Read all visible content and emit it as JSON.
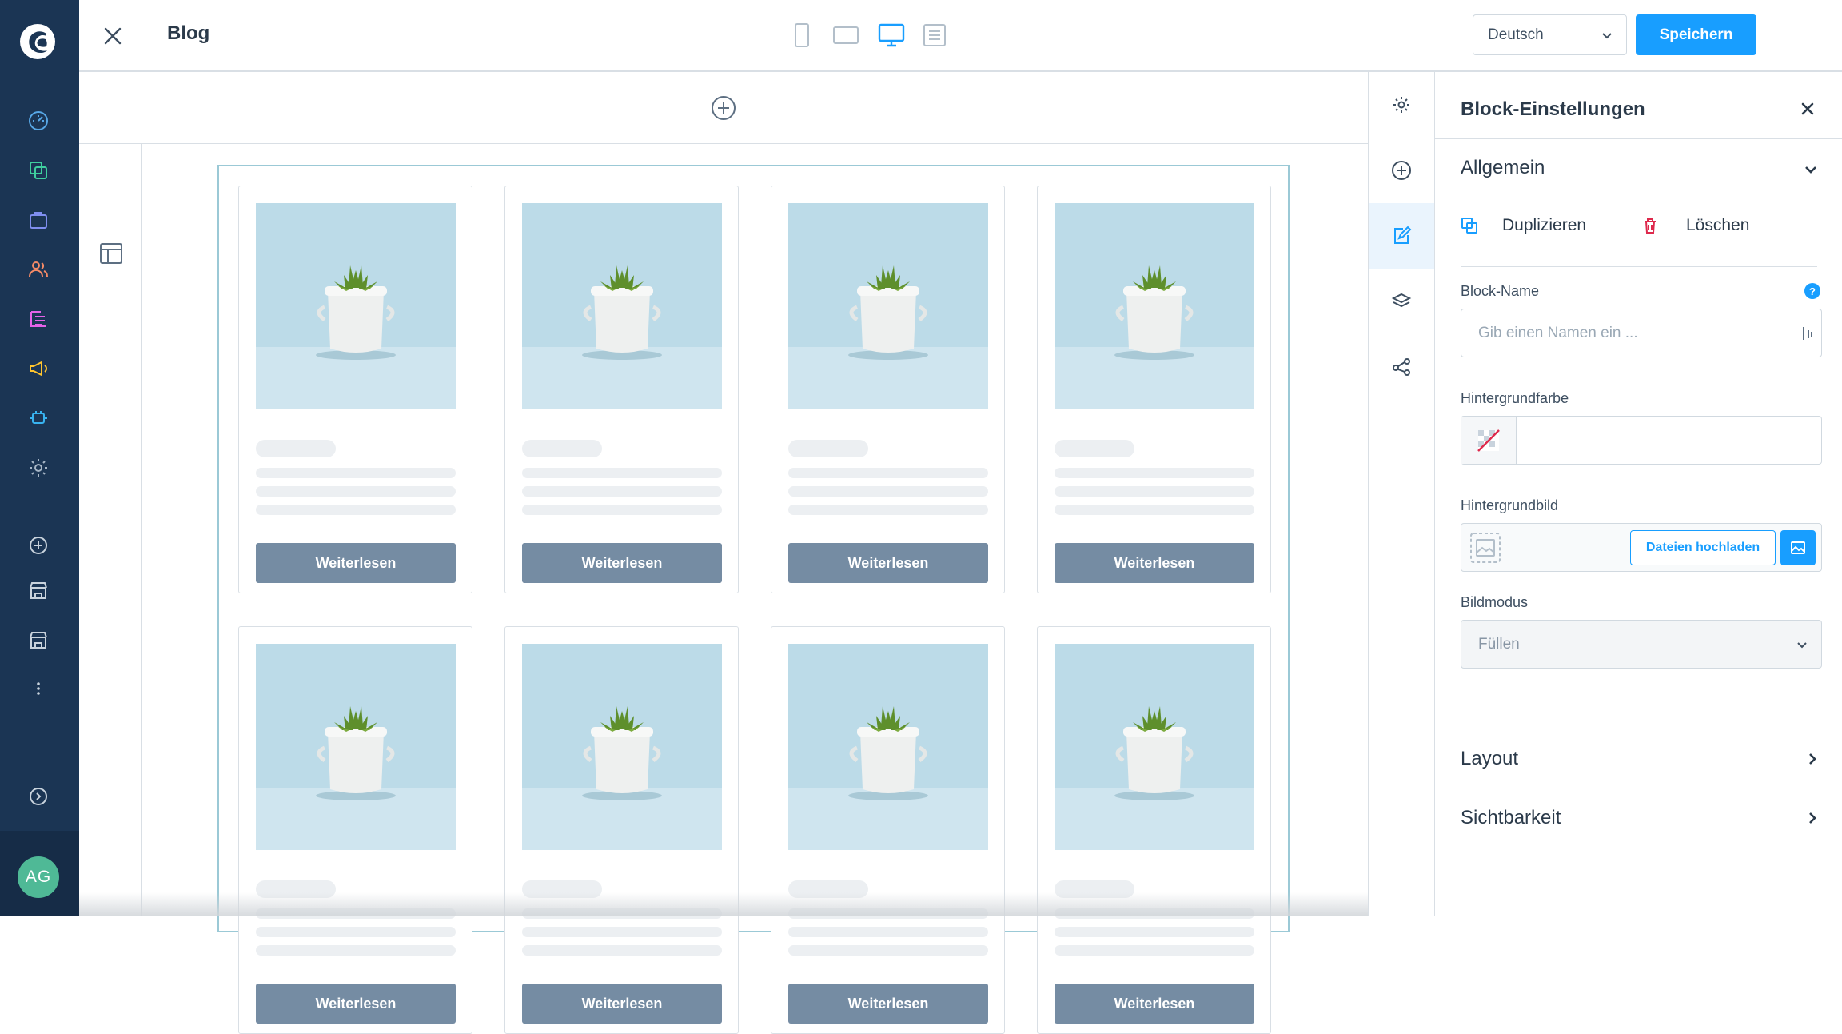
{
  "nav": {
    "avatar_initials": "AG",
    "items": [
      "dashboard-icon",
      "catalogues-icon",
      "orders-icon",
      "customers-icon",
      "content-icon",
      "marketing-icon",
      "extensions-icon",
      "settings-icon",
      "add-sales-channel-icon",
      "storefront-icon",
      "storefront-icon",
      "more-icon",
      "help-icon"
    ]
  },
  "topbar": {
    "title": "Blog",
    "language": "Deutsch",
    "save_label": "Speichern",
    "active_device": "desktop"
  },
  "canvas": {
    "cards": [
      {
        "button_label": "Weiterlesen"
      },
      {
        "button_label": "Weiterlesen"
      },
      {
        "button_label": "Weiterlesen"
      },
      {
        "button_label": "Weiterlesen"
      },
      {
        "button_label": "Weiterlesen"
      },
      {
        "button_label": "Weiterlesen"
      },
      {
        "button_label": "Weiterlesen"
      },
      {
        "button_label": "Weiterlesen"
      }
    ]
  },
  "panel": {
    "title": "Block-Einstellungen",
    "section_general": "Allgemein",
    "duplicate_label": "Duplizieren",
    "delete_label": "Löschen",
    "block_name_label": "Block-Name",
    "block_name_placeholder": "Gib einen Namen ein ...",
    "help_glyph": "?",
    "background_color_label": "Hintergrundfarbe",
    "background_image_label": "Hintergrundbild",
    "upload_label": "Dateien hochladen",
    "image_mode_label": "Bildmodus",
    "image_mode_value": "Füllen",
    "section_layout": "Layout",
    "section_visibility": "Sichtbarkeit"
  },
  "colors": {
    "nav_bg": "#1b3554",
    "accent": "#189eff",
    "card_button": "#758ca3",
    "avatar": "#4fb996"
  }
}
